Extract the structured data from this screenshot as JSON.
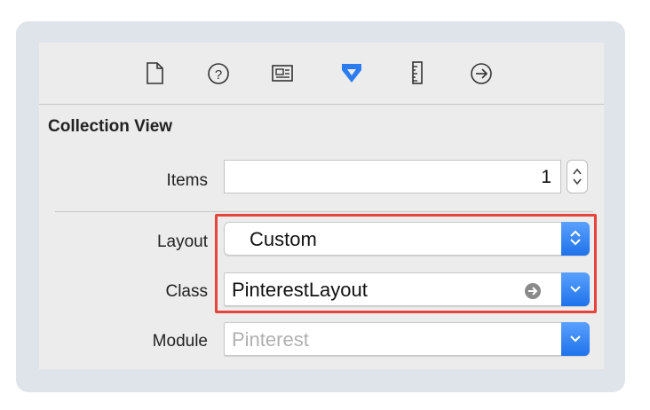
{
  "toolbar": {
    "icons": [
      "file-icon",
      "help-icon",
      "identity-icon",
      "attributes-icon",
      "size-icon",
      "connections-icon"
    ]
  },
  "section": {
    "title": "Collection View"
  },
  "items": {
    "label": "Items",
    "value": "1"
  },
  "layout": {
    "label": "Layout",
    "value": "Custom"
  },
  "class": {
    "label": "Class",
    "value": "PinterestLayout"
  },
  "module": {
    "label": "Module",
    "placeholder": "Pinterest"
  },
  "colors": {
    "accent": "#2b7cf0",
    "highlight": "#e5453a"
  }
}
